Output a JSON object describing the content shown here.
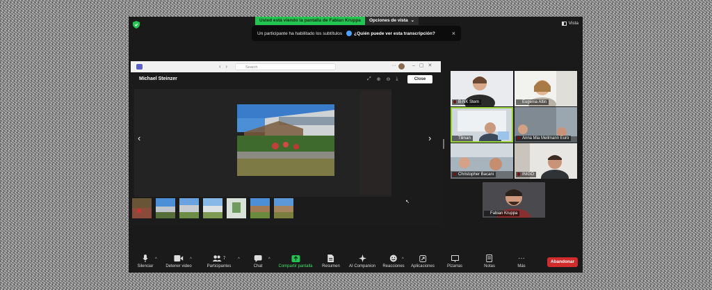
{
  "meeting": {
    "share_banner": "Usted está viendo la pantalla de Fabian Kruppa",
    "view_options": "Opciones de vista",
    "view_label": "Vista",
    "caption_notice": "Un participante ha habilitado los subtítulos",
    "caption_question": "¿Quién puede ver esta transcripción?"
  },
  "shared_screen": {
    "search_placeholder": "Search",
    "viewer_title": "Michael Steinzer",
    "close_label": "Close",
    "thumbnail_count": 7
  },
  "participants": [
    {
      "name": "B-NK Stem",
      "muted": true
    },
    {
      "name": "Eugenia Altin",
      "muted": false
    },
    {
      "name": "Tilman",
      "muted": false,
      "active": true
    },
    {
      "name": "Anna Mia Mellmann Euro",
      "muted": true
    },
    {
      "name": "Christopher Bacani",
      "muted": true
    },
    {
      "name": "INIGO",
      "muted": true
    },
    {
      "name": "Fabian Kruppa",
      "muted": false
    }
  ],
  "toolbar": {
    "mute": "Silenciar",
    "stop_video": "Detener video",
    "participants": "Participantes",
    "participants_count": "7",
    "chat": "Chat",
    "share_screen": "Compartir pantalla",
    "summary": "Resumen",
    "ai_companion": "AI Companion",
    "reactions": "Reacciones",
    "apps": "Aplicaciones",
    "whiteboards": "Pizarras",
    "notes": "Notas",
    "more": "Más",
    "leave": "Abandonar"
  },
  "colors": {
    "share_green": "#23c552",
    "active_speaker": "#9bd13a",
    "leave_red": "#d12b2b",
    "window_bg": "#1a1a1a"
  }
}
